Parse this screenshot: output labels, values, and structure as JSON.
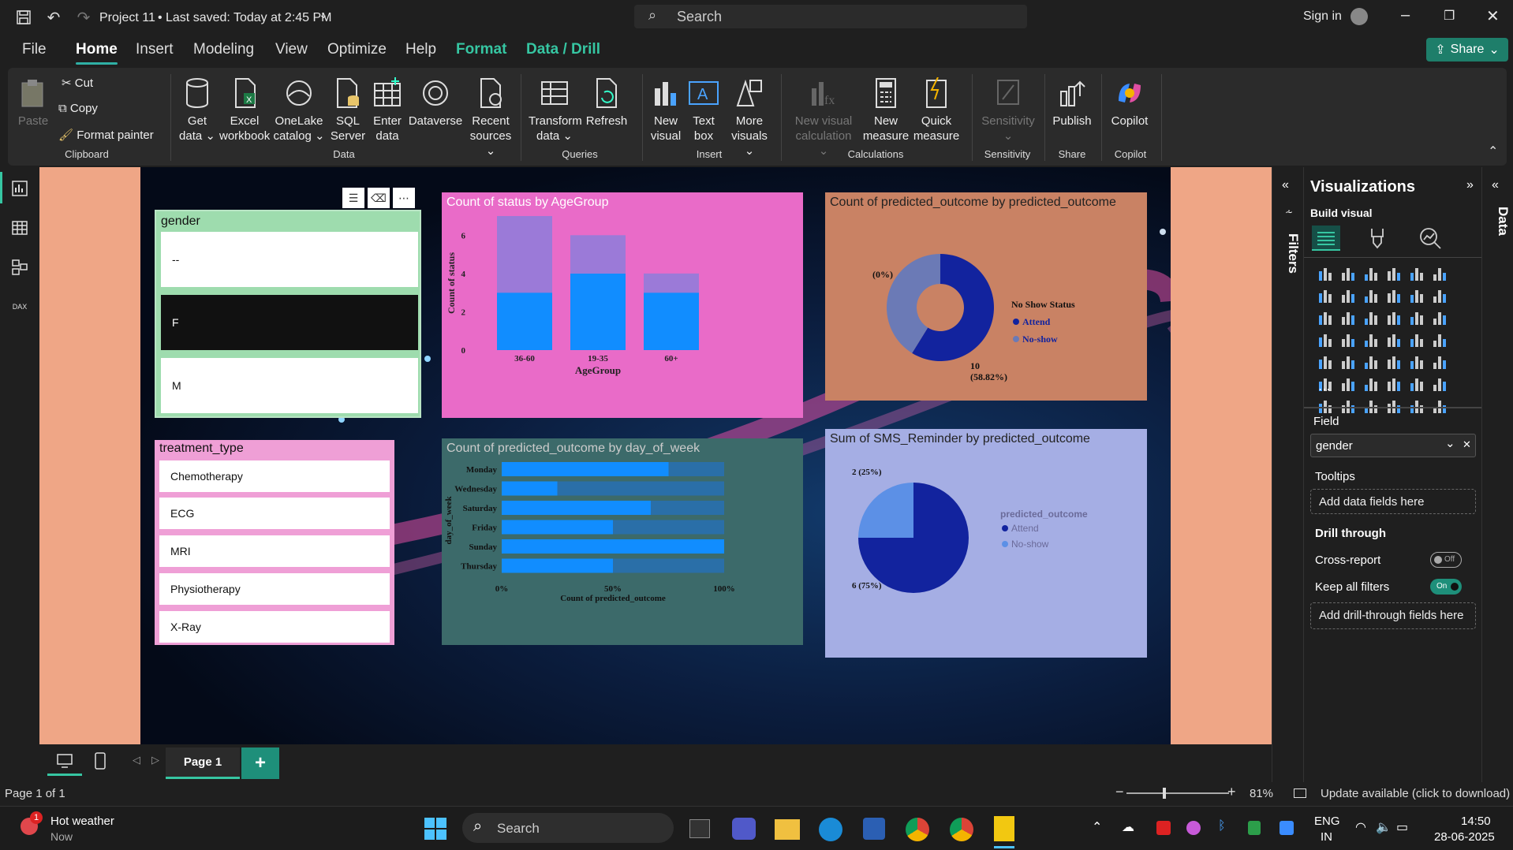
{
  "titlebar": {
    "project": "Project 11",
    "saved": "Last saved: Today at 2:45 PM",
    "search_placeholder": "Search",
    "sign_in": "Sign in"
  },
  "menu": {
    "file": "File",
    "home": "Home",
    "insert": "Insert",
    "modeling": "Modeling",
    "view": "View",
    "optimize": "Optimize",
    "help": "Help",
    "format": "Format",
    "data_drill": "Data / Drill",
    "share": "Share"
  },
  "ribbon": {
    "paste": "Paste",
    "cut": "Cut",
    "copy": "Copy",
    "format_painter": "Format painter",
    "clipboard": "Clipboard",
    "get_data_1": "Get",
    "get_data_2": "data",
    "excel_1": "Excel",
    "excel_2": "workbook",
    "onelake_1": "OneLake",
    "onelake_2": "catalog",
    "sql_1": "SQL",
    "sql_2": "Server",
    "enter_1": "Enter",
    "enter_2": "data",
    "dataverse": "Dataverse",
    "recent_1": "Recent",
    "recent_2": "sources",
    "data_group": "Data",
    "transform_1": "Transform",
    "transform_2": "data",
    "refresh": "Refresh",
    "queries": "Queries",
    "new_visual_1": "New",
    "new_visual_2": "visual",
    "text_box_1": "Text",
    "text_box_2": "box",
    "more_visuals_1": "More",
    "more_visuals_2": "visuals",
    "insert_group": "Insert",
    "new_visual_calc_1": "New visual",
    "new_visual_calc_2": "calculation",
    "new_measure_1": "New",
    "new_measure_2": "measure",
    "quick_measure_1": "Quick",
    "quick_measure_2": "measure",
    "calculations": "Calculations",
    "sensitivity_btn": "Sensitivity",
    "sensitivity_group": "Sensitivity",
    "publish": "Publish",
    "share_group": "Share",
    "copilot_btn": "Copilot",
    "copilot_group": "Copilot"
  },
  "slicer_gender": {
    "title": "gender",
    "items": [
      "--",
      "F",
      "M"
    ]
  },
  "slicer_treatment": {
    "title": "treatment_type",
    "items": [
      "Chemotherapy",
      "ECG",
      "MRI",
      "Physiotherapy",
      "X-Ray"
    ]
  },
  "chart_data": [
    {
      "type": "bar",
      "title": "Count of status by AgeGroup",
      "xlabel": "AgeGroup",
      "ylabel": "Count of status",
      "categories": [
        "36-60",
        "19-35",
        "60+"
      ],
      "series": [
        {
          "values": [
            3,
            4,
            3
          ]
        },
        {
          "values": [
            4,
            2,
            1
          ]
        }
      ],
      "yticks": [
        "0",
        "2",
        "4",
        "6"
      ],
      "ylim": [
        0,
        7
      ],
      "colors": [
        "#118dff",
        "#9b7ad8"
      ]
    },
    {
      "type": "pie",
      "title": "Count of predicted_outcome by predicted_outcome",
      "legend_title": "No Show Status",
      "legend": [
        "Attend",
        "No-show"
      ],
      "values": [
        10,
        7
      ],
      "labels": [
        "10\n(58.82%)",
        "(0%)"
      ],
      "donut": true,
      "colors": [
        "#12239e",
        "#6b7ab6"
      ]
    },
    {
      "type": "bar",
      "orientation": "horizontal",
      "title": "Count of predicted_outcome by day_of_week",
      "xlabel": "Count of predicted_outcome",
      "ylabel": "day_of_week",
      "categories": [
        "Monday",
        "Wednesday",
        "Saturday",
        "Friday",
        "Sunday",
        "Thursday"
      ],
      "values": [
        75,
        25,
        67,
        50,
        100,
        50
      ],
      "xticks": [
        "0%",
        "50%",
        "100%"
      ],
      "colors": [
        "#118dff",
        "#2a6fa8"
      ]
    },
    {
      "type": "pie",
      "title": "Sum of SMS_Reminder by predicted_outcome",
      "legend_title": "predicted_outcome",
      "legend": [
        "Attend",
        "No-show"
      ],
      "values": [
        6,
        2
      ],
      "labels": [
        "6 (75%)",
        "2 (25%)"
      ],
      "colors": [
        "#12239e",
        "#5c90e6"
      ]
    }
  ],
  "pages": {
    "tab": "Page 1",
    "status": "Page 1 of 1"
  },
  "status": {
    "zoom": "81%",
    "update": "Update available (click to download)"
  },
  "filters_label": "Filters",
  "viz_pane": {
    "title": "Visualizations",
    "build": "Build visual",
    "field_label": "Field",
    "field_value": "gender",
    "tooltips": "Tooltips",
    "add_data": "Add data fields here",
    "drill": "Drill through",
    "cross_report": "Cross-report",
    "cross_state": "Off",
    "keep_filters": "Keep all filters",
    "keep_state": "On",
    "add_drill": "Add drill-through fields here"
  },
  "data_label": "Data",
  "taskbar": {
    "weather": "Hot weather",
    "now": "Now",
    "badge": "1",
    "search": "Search",
    "lang1": "ENG",
    "lang2": "IN",
    "time": "14:50",
    "date": "28-06-2025"
  }
}
